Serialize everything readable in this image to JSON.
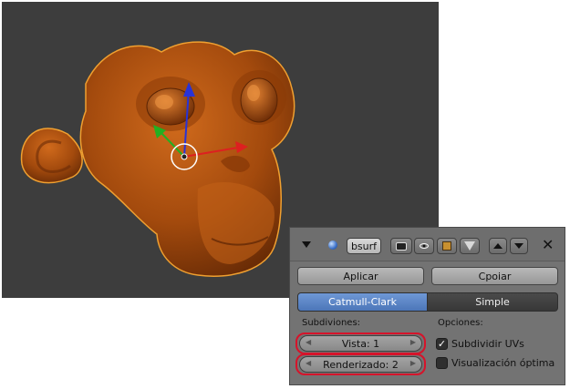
{
  "viewport": {
    "background_color": "#3d3d3d",
    "object_color": "#b5520e",
    "outline_color": "#f0a030"
  },
  "panel": {
    "header": {
      "collapse_icon": "triangle-down-icon",
      "modifier_icon": "sphere-icon",
      "name": "bsurf",
      "render_icon": "camera-icon",
      "view_icon": "eye-icon",
      "edit_icon": "edit-cage-icon",
      "cage_icon": "vertex-triangle-icon",
      "move_up_icon": "arrow-up-icon",
      "move_down_icon": "arrow-down-icon",
      "close_icon": "close-icon"
    },
    "apply_label": "Aplicar",
    "copy_label": "Cpoiar",
    "tabs": [
      {
        "label": "Catmull-Clark",
        "active": true
      },
      {
        "label": "Simple",
        "active": false
      }
    ],
    "subdivisions_label": "Subdiviones:",
    "view_field": "Vista: 1",
    "render_field": "Renderizado: 2",
    "options_label": "Opciones:",
    "option_uvs": {
      "label": "Subdividir UVs",
      "checked": true
    },
    "option_optimal": {
      "label": "Visualización óptima",
      "checked": false
    },
    "highlight_color": "#d6132a",
    "active_tab_color": "#5f89c9"
  }
}
